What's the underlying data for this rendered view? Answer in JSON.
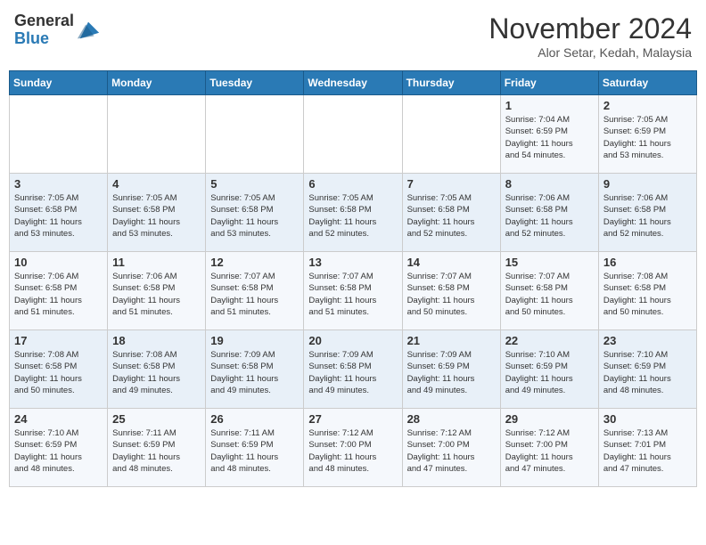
{
  "header": {
    "logo_general": "General",
    "logo_blue": "Blue",
    "month_title": "November 2024",
    "subtitle": "Alor Setar, Kedah, Malaysia"
  },
  "days_of_week": [
    "Sunday",
    "Monday",
    "Tuesday",
    "Wednesday",
    "Thursday",
    "Friday",
    "Saturday"
  ],
  "weeks": [
    [
      {
        "day": "",
        "info": ""
      },
      {
        "day": "",
        "info": ""
      },
      {
        "day": "",
        "info": ""
      },
      {
        "day": "",
        "info": ""
      },
      {
        "day": "",
        "info": ""
      },
      {
        "day": "1",
        "info": "Sunrise: 7:04 AM\nSunset: 6:59 PM\nDaylight: 11 hours\nand 54 minutes."
      },
      {
        "day": "2",
        "info": "Sunrise: 7:05 AM\nSunset: 6:59 PM\nDaylight: 11 hours\nand 53 minutes."
      }
    ],
    [
      {
        "day": "3",
        "info": "Sunrise: 7:05 AM\nSunset: 6:58 PM\nDaylight: 11 hours\nand 53 minutes."
      },
      {
        "day": "4",
        "info": "Sunrise: 7:05 AM\nSunset: 6:58 PM\nDaylight: 11 hours\nand 53 minutes."
      },
      {
        "day": "5",
        "info": "Sunrise: 7:05 AM\nSunset: 6:58 PM\nDaylight: 11 hours\nand 53 minutes."
      },
      {
        "day": "6",
        "info": "Sunrise: 7:05 AM\nSunset: 6:58 PM\nDaylight: 11 hours\nand 52 minutes."
      },
      {
        "day": "7",
        "info": "Sunrise: 7:05 AM\nSunset: 6:58 PM\nDaylight: 11 hours\nand 52 minutes."
      },
      {
        "day": "8",
        "info": "Sunrise: 7:06 AM\nSunset: 6:58 PM\nDaylight: 11 hours\nand 52 minutes."
      },
      {
        "day": "9",
        "info": "Sunrise: 7:06 AM\nSunset: 6:58 PM\nDaylight: 11 hours\nand 52 minutes."
      }
    ],
    [
      {
        "day": "10",
        "info": "Sunrise: 7:06 AM\nSunset: 6:58 PM\nDaylight: 11 hours\nand 51 minutes."
      },
      {
        "day": "11",
        "info": "Sunrise: 7:06 AM\nSunset: 6:58 PM\nDaylight: 11 hours\nand 51 minutes."
      },
      {
        "day": "12",
        "info": "Sunrise: 7:07 AM\nSunset: 6:58 PM\nDaylight: 11 hours\nand 51 minutes."
      },
      {
        "day": "13",
        "info": "Sunrise: 7:07 AM\nSunset: 6:58 PM\nDaylight: 11 hours\nand 51 minutes."
      },
      {
        "day": "14",
        "info": "Sunrise: 7:07 AM\nSunset: 6:58 PM\nDaylight: 11 hours\nand 50 minutes."
      },
      {
        "day": "15",
        "info": "Sunrise: 7:07 AM\nSunset: 6:58 PM\nDaylight: 11 hours\nand 50 minutes."
      },
      {
        "day": "16",
        "info": "Sunrise: 7:08 AM\nSunset: 6:58 PM\nDaylight: 11 hours\nand 50 minutes."
      }
    ],
    [
      {
        "day": "17",
        "info": "Sunrise: 7:08 AM\nSunset: 6:58 PM\nDaylight: 11 hours\nand 50 minutes."
      },
      {
        "day": "18",
        "info": "Sunrise: 7:08 AM\nSunset: 6:58 PM\nDaylight: 11 hours\nand 49 minutes."
      },
      {
        "day": "19",
        "info": "Sunrise: 7:09 AM\nSunset: 6:58 PM\nDaylight: 11 hours\nand 49 minutes."
      },
      {
        "day": "20",
        "info": "Sunrise: 7:09 AM\nSunset: 6:58 PM\nDaylight: 11 hours\nand 49 minutes."
      },
      {
        "day": "21",
        "info": "Sunrise: 7:09 AM\nSunset: 6:59 PM\nDaylight: 11 hours\nand 49 minutes."
      },
      {
        "day": "22",
        "info": "Sunrise: 7:10 AM\nSunset: 6:59 PM\nDaylight: 11 hours\nand 49 minutes."
      },
      {
        "day": "23",
        "info": "Sunrise: 7:10 AM\nSunset: 6:59 PM\nDaylight: 11 hours\nand 48 minutes."
      }
    ],
    [
      {
        "day": "24",
        "info": "Sunrise: 7:10 AM\nSunset: 6:59 PM\nDaylight: 11 hours\nand 48 minutes."
      },
      {
        "day": "25",
        "info": "Sunrise: 7:11 AM\nSunset: 6:59 PM\nDaylight: 11 hours\nand 48 minutes."
      },
      {
        "day": "26",
        "info": "Sunrise: 7:11 AM\nSunset: 6:59 PM\nDaylight: 11 hours\nand 48 minutes."
      },
      {
        "day": "27",
        "info": "Sunrise: 7:12 AM\nSunset: 7:00 PM\nDaylight: 11 hours\nand 48 minutes."
      },
      {
        "day": "28",
        "info": "Sunrise: 7:12 AM\nSunset: 7:00 PM\nDaylight: 11 hours\nand 47 minutes."
      },
      {
        "day": "29",
        "info": "Sunrise: 7:12 AM\nSunset: 7:00 PM\nDaylight: 11 hours\nand 47 minutes."
      },
      {
        "day": "30",
        "info": "Sunrise: 7:13 AM\nSunset: 7:01 PM\nDaylight: 11 hours\nand 47 minutes."
      }
    ]
  ]
}
